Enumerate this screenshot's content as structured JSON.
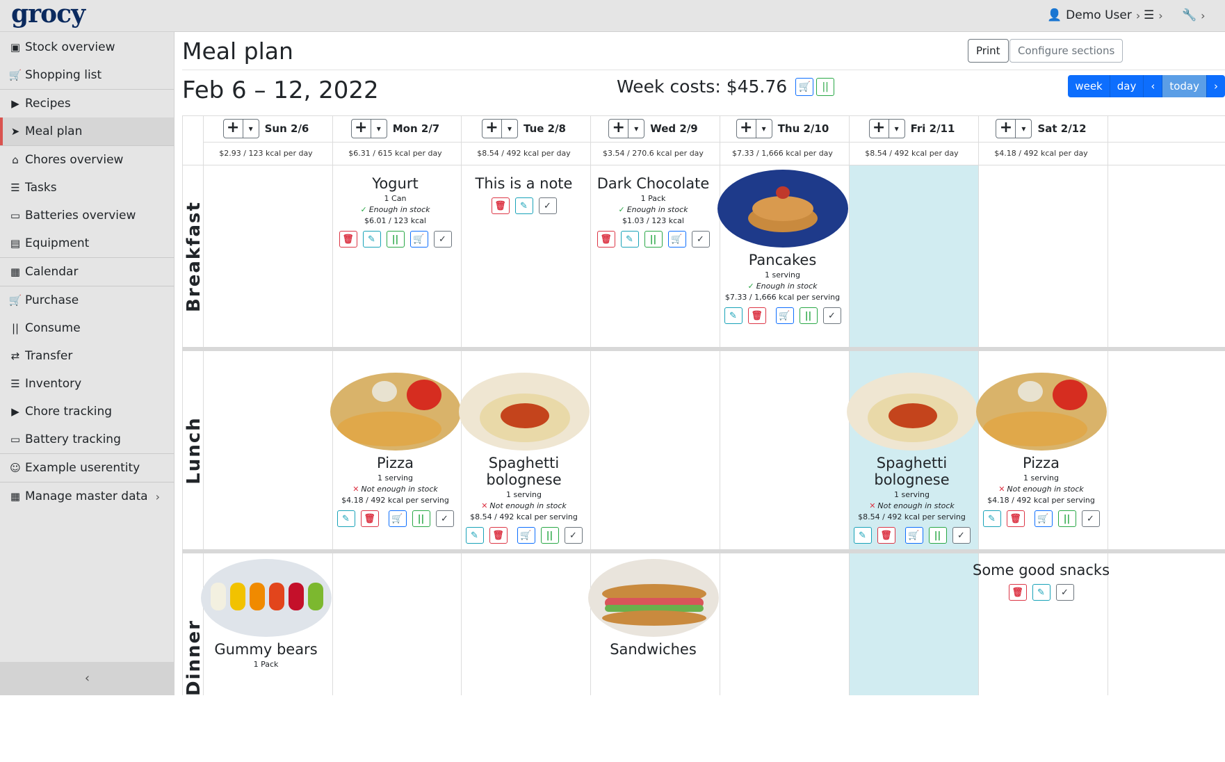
{
  "app": {
    "logo": "grocy"
  },
  "topnav": {
    "user": "Demo User"
  },
  "sidebar": {
    "items": [
      {
        "label": "Stock overview",
        "icon": "box-icon"
      },
      {
        "label": "Shopping list",
        "icon": "cart-icon"
      },
      {
        "label": "Recipes",
        "icon": "pizza-icon"
      },
      {
        "label": "Meal plan",
        "icon": "paper-plane-icon",
        "active": true
      },
      {
        "label": "Chores overview",
        "icon": "home-icon"
      },
      {
        "label": "Tasks",
        "icon": "tasks-icon"
      },
      {
        "label": "Batteries overview",
        "icon": "battery-icon"
      },
      {
        "label": "Equipment",
        "icon": "toolbox-icon"
      },
      {
        "label": "Calendar",
        "icon": "calendar-icon"
      },
      {
        "label": "Purchase",
        "icon": "cart-plus-icon"
      },
      {
        "label": "Consume",
        "icon": "utensils-icon"
      },
      {
        "label": "Transfer",
        "icon": "exchange-icon"
      },
      {
        "label": "Inventory",
        "icon": "list-icon"
      },
      {
        "label": "Chore tracking",
        "icon": "play-icon"
      },
      {
        "label": "Battery tracking",
        "icon": "car-battery-icon"
      },
      {
        "label": "Example userentity",
        "icon": "smile-icon"
      },
      {
        "label": "Manage master data",
        "icon": "table-icon"
      }
    ]
  },
  "main": {
    "title": "Meal plan",
    "print_label": "Print",
    "configure_label": "Configure sections",
    "week_range": "Feb 6 – 12, 2022",
    "week_costs": "Week costs: $45.76",
    "views": {
      "week": "week",
      "day": "day",
      "prev": "‹",
      "today": "today",
      "next": "›"
    }
  },
  "days": [
    {
      "name": "Sun 2/6",
      "cost": "$2.93 / 123 kcal per day"
    },
    {
      "name": "Mon 2/7",
      "cost": "$6.31 / 615 kcal per day"
    },
    {
      "name": "Tue 2/8",
      "cost": "$8.54 / 492 kcal per day"
    },
    {
      "name": "Wed 2/9",
      "cost": "$3.54 / 270.6 kcal per day"
    },
    {
      "name": "Thu 2/10",
      "cost": "$7.33 / 1,666 kcal per day"
    },
    {
      "name": "Fri 2/11",
      "cost": "$8.54 / 492 kcal per day",
      "today": true
    },
    {
      "name": "Sat 2/12",
      "cost": "$4.18 / 492 kcal per day"
    }
  ],
  "sections": [
    "Breakfast",
    "Lunch",
    "Dinner"
  ],
  "entries": {
    "b_mon": {
      "title": "Yogurt",
      "amount": "1 Can",
      "stock": "Enough in stock",
      "cost": "$6.01 / 123 kcal"
    },
    "b_tue": {
      "title": "This is a note"
    },
    "b_wed": {
      "title": "Dark Chocolate",
      "amount": "1 Pack",
      "stock": "Enough in stock",
      "cost": "$1.03 / 123 kcal"
    },
    "b_thu": {
      "title": "Pancakes",
      "amount": "1 serving",
      "stock": "Enough in stock",
      "cost": "$7.33 / 1,666 kcal per serving"
    },
    "l_mon": {
      "title": "Pizza",
      "amount": "1 serving",
      "stock": "Not enough in stock",
      "cost": "$4.18 / 492 kcal per serving"
    },
    "l_tue": {
      "title": "Spaghetti bolognese",
      "amount": "1 serving",
      "stock": "Not enough in stock",
      "cost": "$8.54 / 492 kcal per serving"
    },
    "l_fri": {
      "title": "Spaghetti bolognese",
      "amount": "1 serving",
      "stock": "Not enough in stock",
      "cost": "$8.54 / 492 kcal per serving"
    },
    "l_sat": {
      "title": "Pizza",
      "amount": "1 serving",
      "stock": "Not enough in stock",
      "cost": "$4.18 / 492 kcal per serving"
    },
    "d_sun": {
      "title": "Gummy bears",
      "amount": "1 Pack"
    },
    "d_wed": {
      "title": "Sandwiches"
    },
    "d_sat": {
      "title": "Some good snacks"
    }
  },
  "colors": {
    "today_bg": "#d1ecf1",
    "accent": "#0d6efd",
    "danger": "#dc3545",
    "success": "#28a745",
    "info": "#17a2b8"
  }
}
